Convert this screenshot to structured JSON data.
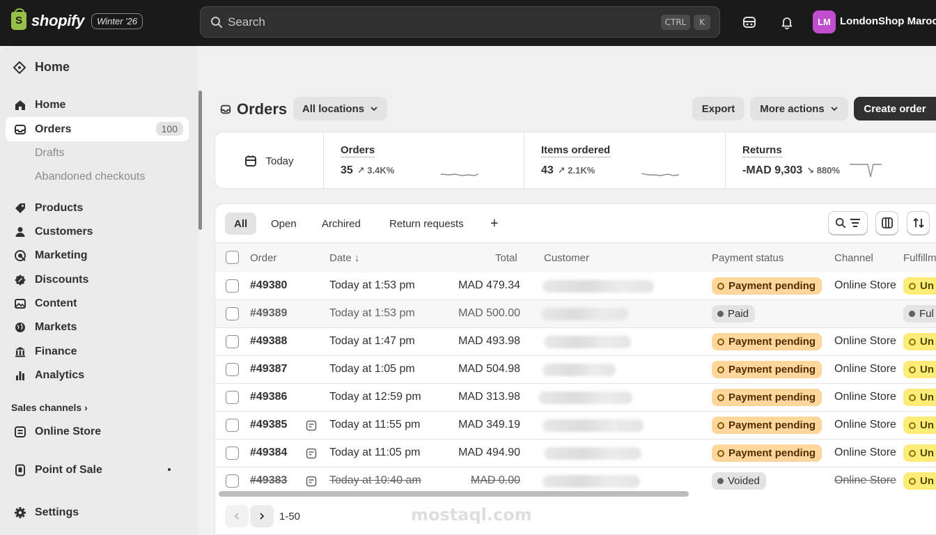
{
  "topbar": {
    "brand": "shopify",
    "brand_glyph": "S",
    "edition_badge": "Winter '26",
    "search_placeholder": "Search",
    "shortcut_keys": [
      "CTRL",
      "K"
    ],
    "avatar_initials": "LM",
    "store_name": "LondonShop Maroc",
    "avatar_color": "#c04fd0"
  },
  "sidebar": {
    "top_link": "Home",
    "items": [
      {
        "label": "Home",
        "icon": "home-icon"
      },
      {
        "label": "Orders",
        "icon": "orders-icon",
        "count": "100",
        "active": true
      },
      {
        "label": "Products",
        "icon": "tag-icon"
      },
      {
        "label": "Customers",
        "icon": "person-icon"
      },
      {
        "label": "Marketing",
        "icon": "target-icon"
      },
      {
        "label": "Discounts",
        "icon": "discount-icon"
      },
      {
        "label": "Content",
        "icon": "image-icon"
      },
      {
        "label": "Markets",
        "icon": "globe-icon"
      },
      {
        "label": "Finance",
        "icon": "bank-icon"
      },
      {
        "label": "Analytics",
        "icon": "bar-chart-icon"
      }
    ],
    "sub_items": [
      "Drafts",
      "Abandoned checkouts"
    ],
    "sales_channels_label": "Sales channels",
    "online_store": "Online Store",
    "point_of_sale": "Point of Sale",
    "settings": "Settings"
  },
  "page": {
    "title": "Orders",
    "location_filter": "All locations",
    "export_label": "Export",
    "more_actions_label": "More actions",
    "create_label": "Create order"
  },
  "stats": {
    "period": "Today",
    "orders": {
      "label": "Orders",
      "value": "35",
      "delta": "↗ 3.4K%"
    },
    "items": {
      "label": "Items ordered",
      "value": "43",
      "delta": "↗ 2.1K%"
    },
    "returns": {
      "label": "Returns",
      "value": "-MAD 9,303",
      "delta": "↘ 880%"
    }
  },
  "tabs": [
    "All",
    "Open",
    "Archired",
    "Return requests"
  ],
  "add_tab_symbol": "+",
  "columns": {
    "order": "Order",
    "date": "Date ↓",
    "total": "Total",
    "customer": "Customer",
    "payment": "Payment status",
    "channel": "Channel",
    "fulfillment": "Fulfillm"
  },
  "orders": [
    {
      "id": "#49380",
      "date": "Today at 1:53 pm",
      "total": "MAD 479.34",
      "payment": "Payment pending",
      "channel": "Online Store",
      "fulfillment": "Un"
    },
    {
      "id": "#49389",
      "date": "Today at 1:53 pm",
      "total": "MAD 500.00",
      "payment": "Paid",
      "channel": "",
      "fulfillment": "Ful"
    },
    {
      "id": "#49388",
      "date": "Today at 1:47 pm",
      "total": "MAD 493.98",
      "payment": "Payment pending",
      "channel": "Online Store",
      "fulfillment": "Un"
    },
    {
      "id": "#49387",
      "date": "Today at 1:05 pm",
      "total": "MAD 504.98",
      "payment": "Payment pending",
      "channel": "Online Store",
      "fulfillment": "Un"
    },
    {
      "id": "#49386",
      "date": "Today at 12:59 pm",
      "total": "MAD 313.98",
      "payment": "Payment pending",
      "channel": "Online Store",
      "fulfillment": "Un"
    },
    {
      "id": "#49385",
      "date": "Today at 11:55 pm",
      "total": "MAD 349.19",
      "payment": "Payment pending",
      "channel": "Online Store",
      "fulfillment": "Un"
    },
    {
      "id": "#49384",
      "date": "Today at 11:05 pm",
      "total": "MAD 494.90",
      "payment": "Payment pending",
      "channel": "Online Store",
      "fulfillment": "Un"
    },
    {
      "id": "#49383",
      "date": "Today at 10:40 am",
      "total": "MAD 0.00",
      "payment": "Voided",
      "channel": "Online Store",
      "fulfillment": "Un"
    }
  ],
  "pagination": {
    "range": "1-50"
  },
  "watermark": "mostaql.com"
}
